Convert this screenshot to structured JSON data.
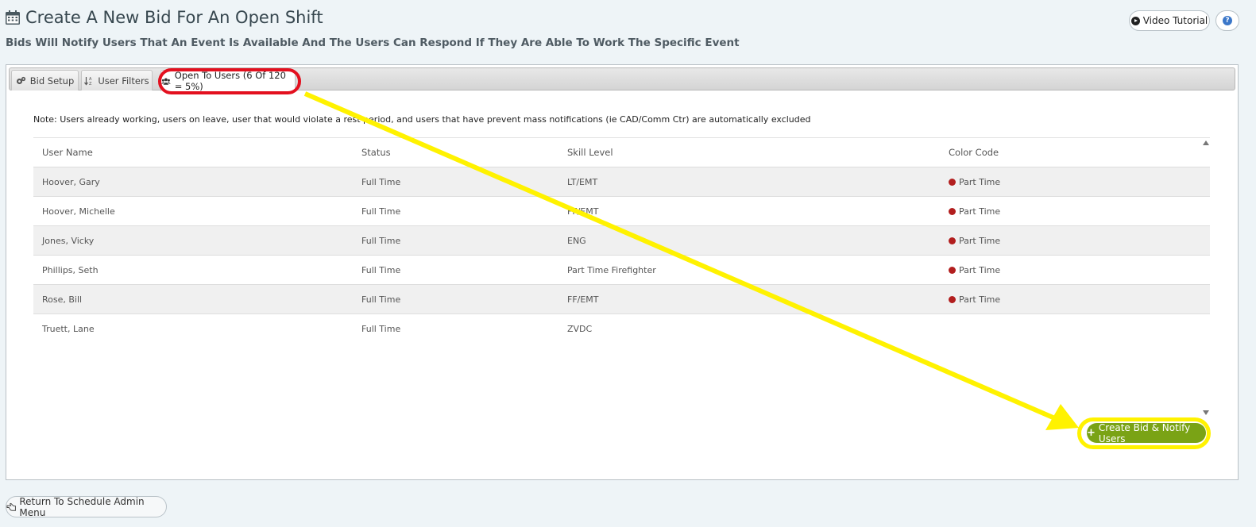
{
  "header": {
    "title": "Create A New Bid For An Open Shift",
    "subtitle": "Bids Will Notify Users That An Event Is Available And The Users Can Respond If They Are Able To Work The Specific Event",
    "video_tutorial": "Video Tutorial",
    "help_glyph": "?"
  },
  "tabs": [
    {
      "label": "Bid Setup",
      "icon": "cogs-icon"
    },
    {
      "label": "User Filters",
      "icon": "sort-alpha-icon"
    },
    {
      "label": "Open To Users (6 Of 120 = 5%)",
      "icon": "users-icon",
      "active": true
    }
  ],
  "note": "Note: Users already working, users on leave, user that would violate a rest period, and users that have prevent mass notifications (ie CAD/Comm Ctr) are automatically excluded",
  "table": {
    "headers": [
      "User Name",
      "Status",
      "Skill Level",
      "Color Code"
    ],
    "rows": [
      {
        "name": "Hoover, Gary",
        "status": "Full Time",
        "skill": "LT/EMT",
        "color_code": "Part Time"
      },
      {
        "name": "Hoover, Michelle",
        "status": "Full Time",
        "skill": "FF/EMT",
        "color_code": "Part Time"
      },
      {
        "name": "Jones, Vicky",
        "status": "Full Time",
        "skill": "ENG",
        "color_code": "Part Time"
      },
      {
        "name": "Phillips, Seth",
        "status": "Full Time",
        "skill": "Part Time Firefighter",
        "color_code": "Part Time"
      },
      {
        "name": "Rose, Bill",
        "status": "Full Time",
        "skill": "FF/EMT",
        "color_code": "Part Time"
      },
      {
        "name": "Truett, Lane",
        "status": "Full Time",
        "skill": "ZVDC",
        "color_code": ""
      }
    ]
  },
  "actions": {
    "create_bid": "Create Bid & Notify Users",
    "return": "Return To Schedule Admin Menu"
  },
  "colors": {
    "accent_green": "#7aa315",
    "color_code_dot": "#b21e1e",
    "highlight_red": "#e3101f",
    "highlight_yellow": "#fff200"
  }
}
